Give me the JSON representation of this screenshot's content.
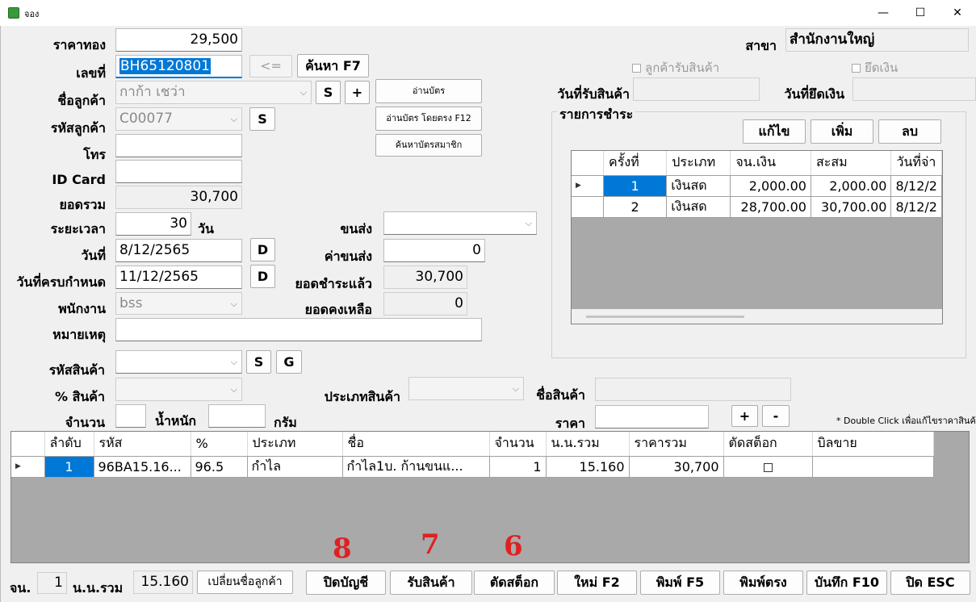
{
  "window": {
    "title": "จอง",
    "minimize": "—",
    "maximize": "☐",
    "close": "✕"
  },
  "form": {
    "gold_price_label": "ราคาทอง",
    "gold_price": "29,500",
    "doc_no_label": "เลขที่",
    "doc_no": "BH65120801",
    "back_button": "<=",
    "search_button": "ค้นหา F7",
    "customer_name_label": "ชื่อลูกค้า",
    "customer_name": "กาก้า เชว่า",
    "s_button": "S",
    "plus_button": "+",
    "read_card_button": "อ่านบัตร",
    "read_card_direct_button": "อ่านบัตร โดยตรง F12",
    "search_member_button": "ค้นหาบัตรสมาชิก",
    "customer_code_label": "รหัสลูกค้า",
    "customer_code": "C00077",
    "phone_label": "โทร",
    "phone": "",
    "id_card_label": "ID Card",
    "id_card": "",
    "total_label": "ยอดรวม",
    "total": "30,700",
    "duration_label": "ระยะเวลา",
    "duration": "30",
    "duration_unit": "วัน",
    "date_label": "วันที่",
    "date": "8/12/2565",
    "d_button": "D",
    "due_date_label": "วันที่ครบกำหนด",
    "due_date": "11/12/2565",
    "employee_label": "พนักงาน",
    "employee": "bss",
    "note_label": "หมายเหตุ",
    "note": "",
    "shipping_label": "ขนส่ง",
    "shipping": "",
    "shipping_cost_label": "ค่าขนส่ง",
    "shipping_cost": "0",
    "paid_label": "ยอดชำระแล้ว",
    "paid": "30,700",
    "remaining_label": "ยอดคงเหลือ",
    "remaining": "0",
    "branch_label": "สาขา",
    "branch": "สำนักงานใหญ่",
    "customer_received_check": "ลูกค้ารับสินค้า",
    "seize_money_check": "ยึดเงิน",
    "receive_date_label": "วันที่รับสินค้า",
    "receive_date": "",
    "seize_date_label": "วันที่ยึดเงิน",
    "seize_date": ""
  },
  "payments": {
    "group_label": "รายการชำระ",
    "edit_button": "แก้ไข",
    "add_button": "เพิ่ม",
    "delete_button": "ลบ",
    "columns": [
      "ครั้งที่",
      "ประเภท",
      "จน.เงิน",
      "สะสม",
      "วันที่จ่า"
    ],
    "rows": [
      {
        "no": "1",
        "type": "เงินสด",
        "amount": "2,000.00",
        "cumulative": "2,000.00",
        "date": "8/12/2"
      },
      {
        "no": "2",
        "type": "เงินสด",
        "amount": "28,700.00",
        "cumulative": "30,700.00",
        "date": "8/12/2"
      }
    ]
  },
  "product_entry": {
    "product_code_label": "รหัสสินค้า",
    "s_button": "S",
    "g_button": "G",
    "percent_label": "% สินค้า",
    "product_type_label": "ประเภทสินค้า",
    "product_name_label": "ชื่อสินค้า",
    "qty_label": "จำนวน",
    "weight_label": "น้ำหนัก",
    "gram_label": "กรัม",
    "price_label": "ราคา",
    "plus_button": "+",
    "minus_button": "-",
    "hint": "* Double Click เพื่อแก้ไขราคาสินค้า"
  },
  "items": {
    "columns": [
      "ลำดับ",
      "รหัส",
      "%",
      "ประเภท",
      "ชื่อ",
      "จำนวน",
      "น.น.รวม",
      "ราคารวม",
      "ตัดสต็อก",
      "บิลขาย"
    ],
    "rows": [
      {
        "seq": "1",
        "code": "96BA15.16...",
        "percent": "96.5",
        "type": "กำไล",
        "name": "กำไล1บ. ก้านขนแ...",
        "qty": "1",
        "weight": "15.160",
        "price": "30,700",
        "bill": ""
      }
    ]
  },
  "footer": {
    "count_label": "จน.",
    "count": "1",
    "weight_total_label": "น.น.รวม",
    "weight_total": "15.160",
    "change_customer_button": "เปลี่ยนชื่อลูกค้า",
    "close_account_button": "ปิดบัญชี",
    "receive_goods_button": "รับสินค้า",
    "cut_stock_button": "ตัดสต็อก",
    "new_button": "ใหม่ F2",
    "print_button": "พิมพ์ F5",
    "print_direct_button": "พิมพ์ตรง",
    "save_button": "บันทึก F10",
    "close_button": "ปิด ESC",
    "annotation_8": "8",
    "annotation_7": "7",
    "annotation_6": "6"
  }
}
